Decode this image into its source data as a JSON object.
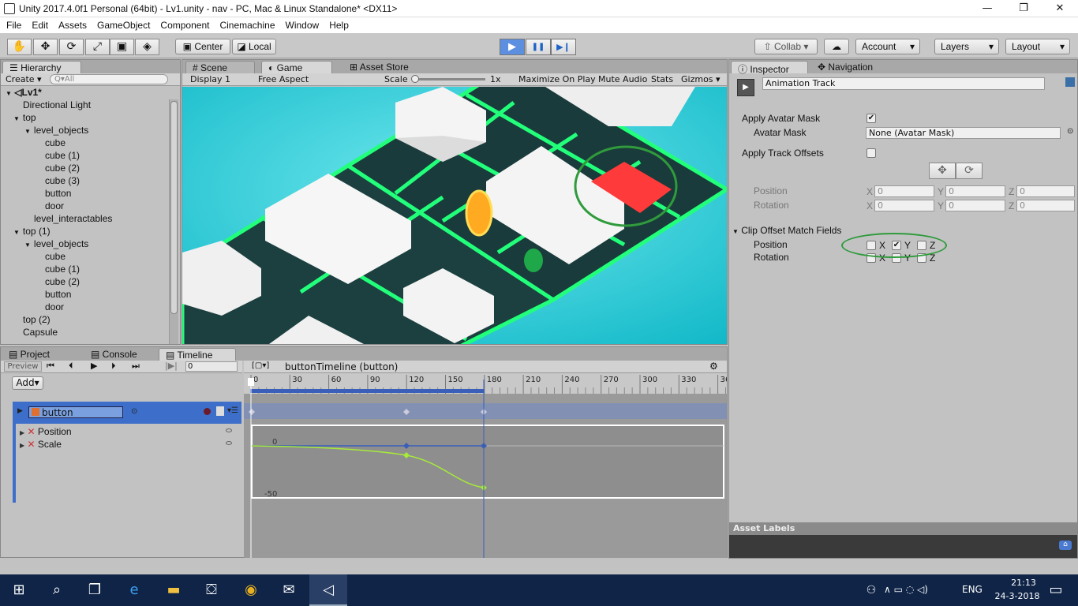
{
  "window": {
    "title": "Unity 2017.4.0f1 Personal (64bit) - Lv1.unity - nav - PC, Mac & Linux Standalone* <DX11>",
    "min": "—",
    "max": "❐",
    "close": "✕"
  },
  "menu": [
    "File",
    "Edit",
    "Assets",
    "GameObject",
    "Component",
    "Cinemachine",
    "Window",
    "Help"
  ],
  "toolbar": {
    "tools": [
      "✋",
      "✥",
      "⟳",
      "⤢",
      "▣",
      "◈"
    ],
    "pivot": "Center",
    "space": "Local",
    "play": "▶",
    "pause": "❚❚",
    "step": "▶❙",
    "collab": "Collab ▾",
    "account": "Account",
    "layers": "Layers",
    "layout": "Layout"
  },
  "hierarchy": {
    "tab": "Hierarchy",
    "create": "Create ▾",
    "search_placeholder": "Q▾All",
    "scene": "Lv1*",
    "rows": [
      {
        "text": "Directional Light",
        "indent": 1,
        "arrow": ""
      },
      {
        "text": "top",
        "indent": 1,
        "arrow": "▼"
      },
      {
        "text": "level_objects",
        "indent": 2,
        "arrow": "▼"
      },
      {
        "text": "cube",
        "indent": 3,
        "arrow": ""
      },
      {
        "text": "cube (1)",
        "indent": 3,
        "arrow": ""
      },
      {
        "text": "cube (2)",
        "indent": 3,
        "arrow": ""
      },
      {
        "text": "cube (3)",
        "indent": 3,
        "arrow": ""
      },
      {
        "text": "button",
        "indent": 3,
        "arrow": ""
      },
      {
        "text": "door",
        "indent": 3,
        "arrow": ""
      },
      {
        "text": "level_interactables",
        "indent": 2,
        "arrow": ""
      },
      {
        "text": "top (1)",
        "indent": 1,
        "arrow": "▼"
      },
      {
        "text": "level_objects",
        "indent": 2,
        "arrow": "▼"
      },
      {
        "text": "cube",
        "indent": 3,
        "arrow": ""
      },
      {
        "text": "cube (1)",
        "indent": 3,
        "arrow": ""
      },
      {
        "text": "cube (2)",
        "indent": 3,
        "arrow": ""
      },
      {
        "text": "button",
        "indent": 3,
        "arrow": ""
      },
      {
        "text": "door",
        "indent": 3,
        "arrow": ""
      },
      {
        "text": "top (2)",
        "indent": 1,
        "arrow": ""
      },
      {
        "text": "Capsule",
        "indent": 1,
        "arrow": ""
      }
    ]
  },
  "scene_tabs": {
    "scene": "Scene",
    "game": "Game",
    "asset_store": "Asset Store"
  },
  "game_toolbar": {
    "display": "Display 1",
    "aspect": "Free Aspect",
    "scale_label": "Scale",
    "scale_value": "1x",
    "maximize": "Maximize On Play",
    "mute": "Mute Audio",
    "stats": "Stats",
    "gizmos": "Gizmos ▾"
  },
  "bottom_tabs": {
    "project": "Project",
    "console": "Console",
    "timeline": "Timeline"
  },
  "timeline": {
    "preview": "Preview",
    "frame": "0",
    "add": "Add▾",
    "asset_name": "buttonTimeline (button)",
    "track_name": "button",
    "properties": [
      "Position",
      "Scale"
    ],
    "ruler": [
      "0",
      "30",
      "60",
      "90",
      "120",
      "150",
      "180",
      "210",
      "240",
      "270",
      "300",
      "330",
      "36"
    ],
    "curve_labels": {
      "top": "0",
      "bottom": "-50"
    }
  },
  "inspector": {
    "tab": "Inspector",
    "nav_tab": "Navigation",
    "track_name": "Animation Track",
    "apply_avatar_mask": "Apply Avatar Mask",
    "avatar_mask": "Avatar Mask",
    "avatar_mask_value": "None (Avatar Mask)",
    "apply_track_offsets": "Apply Track Offsets",
    "position": "Position",
    "rotation": "Rotation",
    "pos_x": "0",
    "pos_y": "0",
    "pos_z": "0",
    "rot_x": "0",
    "rot_y": "0",
    "rot_z": "0",
    "clip_offset": "Clip Offset Match Fields",
    "axis_x": "X",
    "axis_y": "Y",
    "axis_z": "Z",
    "asset_labels": "Asset Labels"
  },
  "taskbar": {
    "lang": "ENG",
    "time": "21:13",
    "date": "24-3-2018"
  }
}
